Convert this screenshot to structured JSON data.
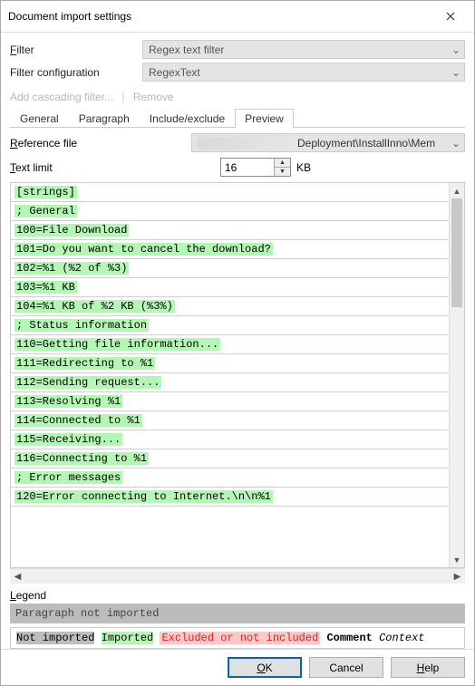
{
  "window": {
    "title": "Document import settings"
  },
  "filter": {
    "label_pre": "F",
    "label_rest": "ilter",
    "value": "Regex text filter"
  },
  "filter_config": {
    "label": "Filter configuration",
    "value": "RegexText"
  },
  "links": {
    "add": "Add cascading filter...",
    "remove": "Remove"
  },
  "tabs": [
    "General",
    "Paragraph",
    "Include/exclude",
    "Preview"
  ],
  "active_tab": 3,
  "reference": {
    "label_pre": "R",
    "label_rest": "eference file",
    "value_tail": "Deployment\\InstallInno\\Mem"
  },
  "text_limit": {
    "label_pre": "T",
    "label_rest": "ext limit",
    "value": "16",
    "unit": "KB"
  },
  "preview_lines": [
    "[strings]",
    "; General",
    "100=File Download",
    "101=Do you want to cancel the download?",
    "102=%1 (%2 of %3)",
    "103=%1 KB",
    "104=%1 KB of %2 KB (%3%)",
    "; Status information",
    "110=Getting file information...",
    "111=Redirecting to %1",
    "112=Sending request...",
    "113=Resolving %1",
    "114=Connected to %1",
    "115=Receiving...",
    "116=Connecting to %1",
    "; Error messages",
    "120=Error connecting to Internet.\\n\\n%1"
  ],
  "legend": {
    "title_pre": "L",
    "title_rest": "egend",
    "line1": "Paragraph not imported",
    "notimp": "Not imported",
    "imp": "Imported",
    "excl": "Excluded or not included",
    "com": "Comment",
    "ctx": "Context"
  },
  "buttons": {
    "ok_pre": "O",
    "ok_rest": "K",
    "cancel": "Cancel",
    "help_pre": "H",
    "help_rest": "elp"
  }
}
